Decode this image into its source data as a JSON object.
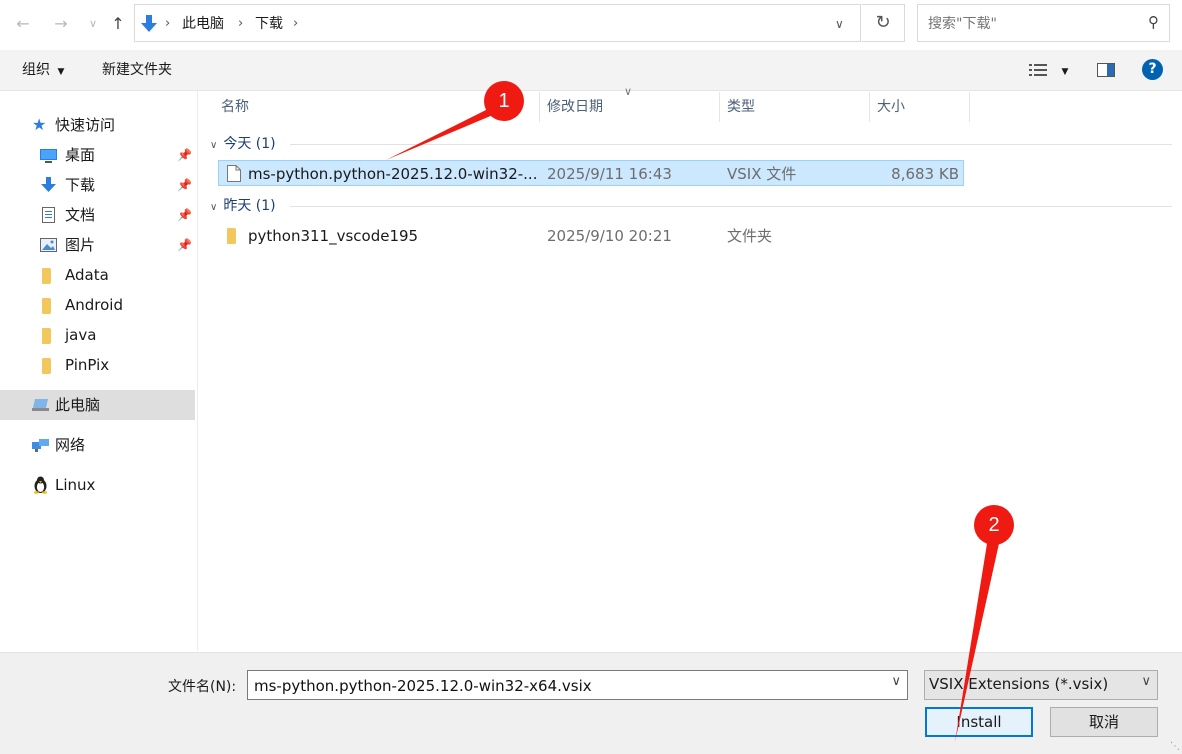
{
  "address_bar": {
    "back_icon": "arrow-left-icon",
    "forward_icon": "arrow-right-icon",
    "recent_icon": "chevron-down-icon",
    "up_icon": "arrow-up-icon",
    "breadcrumb": [
      "此电脑",
      "下载"
    ],
    "refresh_icon": "refresh-icon",
    "search_placeholder": "搜索\"下载\""
  },
  "toolbar": {
    "organize": "组织",
    "new_folder": "新建文件夹"
  },
  "sidebar": {
    "quick_access": "快速访问",
    "pinned": [
      {
        "label": "桌面",
        "icon": "desktop-icon"
      },
      {
        "label": "下载",
        "icon": "download-icon"
      },
      {
        "label": "文档",
        "icon": "document-icon"
      },
      {
        "label": "图片",
        "icon": "picture-icon"
      }
    ],
    "folders": [
      "Adata",
      "Android",
      "java",
      "PinPix"
    ],
    "this_pc": "此电脑",
    "network": "网络",
    "linux": "Linux"
  },
  "columns": {
    "name": "名称",
    "modified": "修改日期",
    "type": "类型",
    "size": "大小"
  },
  "groups": [
    {
      "label": "今天 (1)",
      "items": [
        {
          "name": "ms-python.python-2025.12.0-win32-...",
          "modified": "2025/9/11 16:43",
          "type": "VSIX 文件",
          "size": "8,683 KB",
          "icon": "file-icon",
          "selected": true
        }
      ]
    },
    {
      "label": "昨天 (1)",
      "items": [
        {
          "name": "python311_vscode195",
          "modified": "2025/9/10 20:21",
          "type": "文件夹",
          "size": "",
          "icon": "folder-icon",
          "selected": false
        }
      ]
    }
  ],
  "footer": {
    "filename_label": "文件名(N):",
    "filename_value": "ms-python.python-2025.12.0-win32-x64.vsix",
    "file_type": "VSIX Extensions (*.vsix)",
    "install": "Install",
    "cancel": "取消"
  },
  "annotations": {
    "step1": "1",
    "step2": "2",
    "color": "#ef1a12"
  }
}
